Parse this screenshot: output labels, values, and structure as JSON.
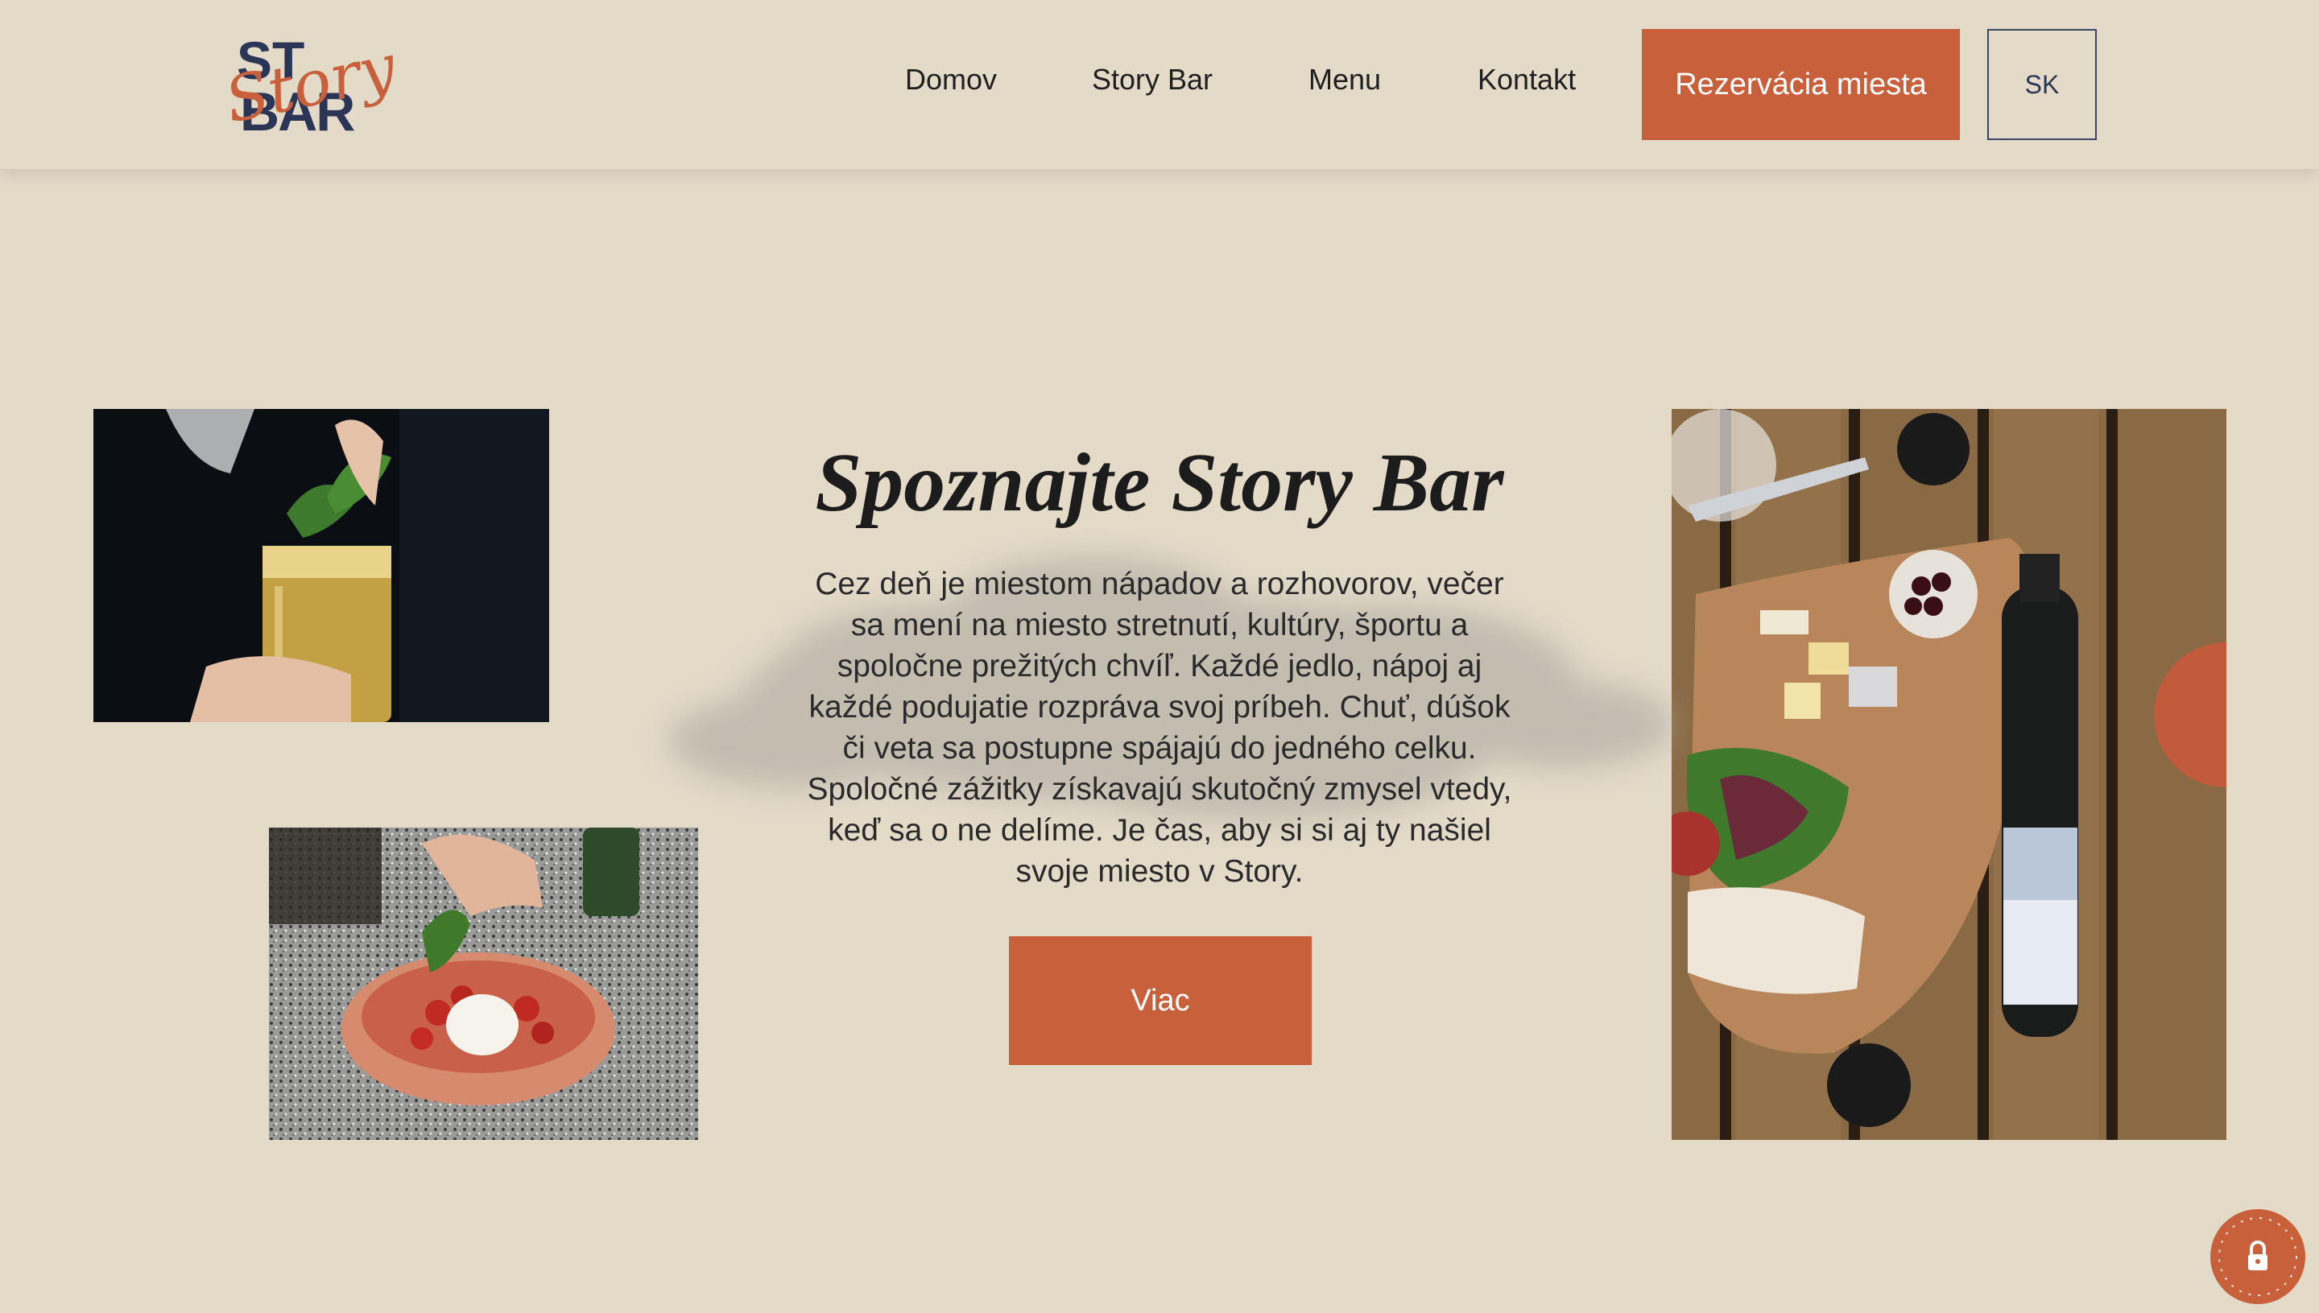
{
  "header": {
    "logo_alt": "Story Bar",
    "nav": [
      {
        "label": "Domov"
      },
      {
        "label": "Story Bar"
      },
      {
        "label": "Menu"
      },
      {
        "label": "Kontakt"
      }
    ],
    "cta_label": "Rezervácia miesta",
    "lang_label": "SK"
  },
  "hero": {
    "title": "Spoznajte Story Bar",
    "description": "Cez deň je miestom nápadov a rozhovorov, večer sa mení na miesto stretnutí, kultúry, športu a spoločne prežitých chvíľ. Každé jedlo, nápoj aj každé podujatie rozpráva svoj príbeh. Chuť, dúšok či veta sa postupne spájajú do jedného celku. Spoločné zážitky získavajú skutočný zmysel vtedy, keď sa o ne delíme. Je čas, aby si si aj ty našiel svoje miesto v Story.",
    "more_label": "Viac"
  },
  "colors": {
    "background": "#e3dac8",
    "accent": "#c9603c",
    "navy": "#2b3657"
  },
  "icons": {
    "cookie": "lock-icon"
  }
}
